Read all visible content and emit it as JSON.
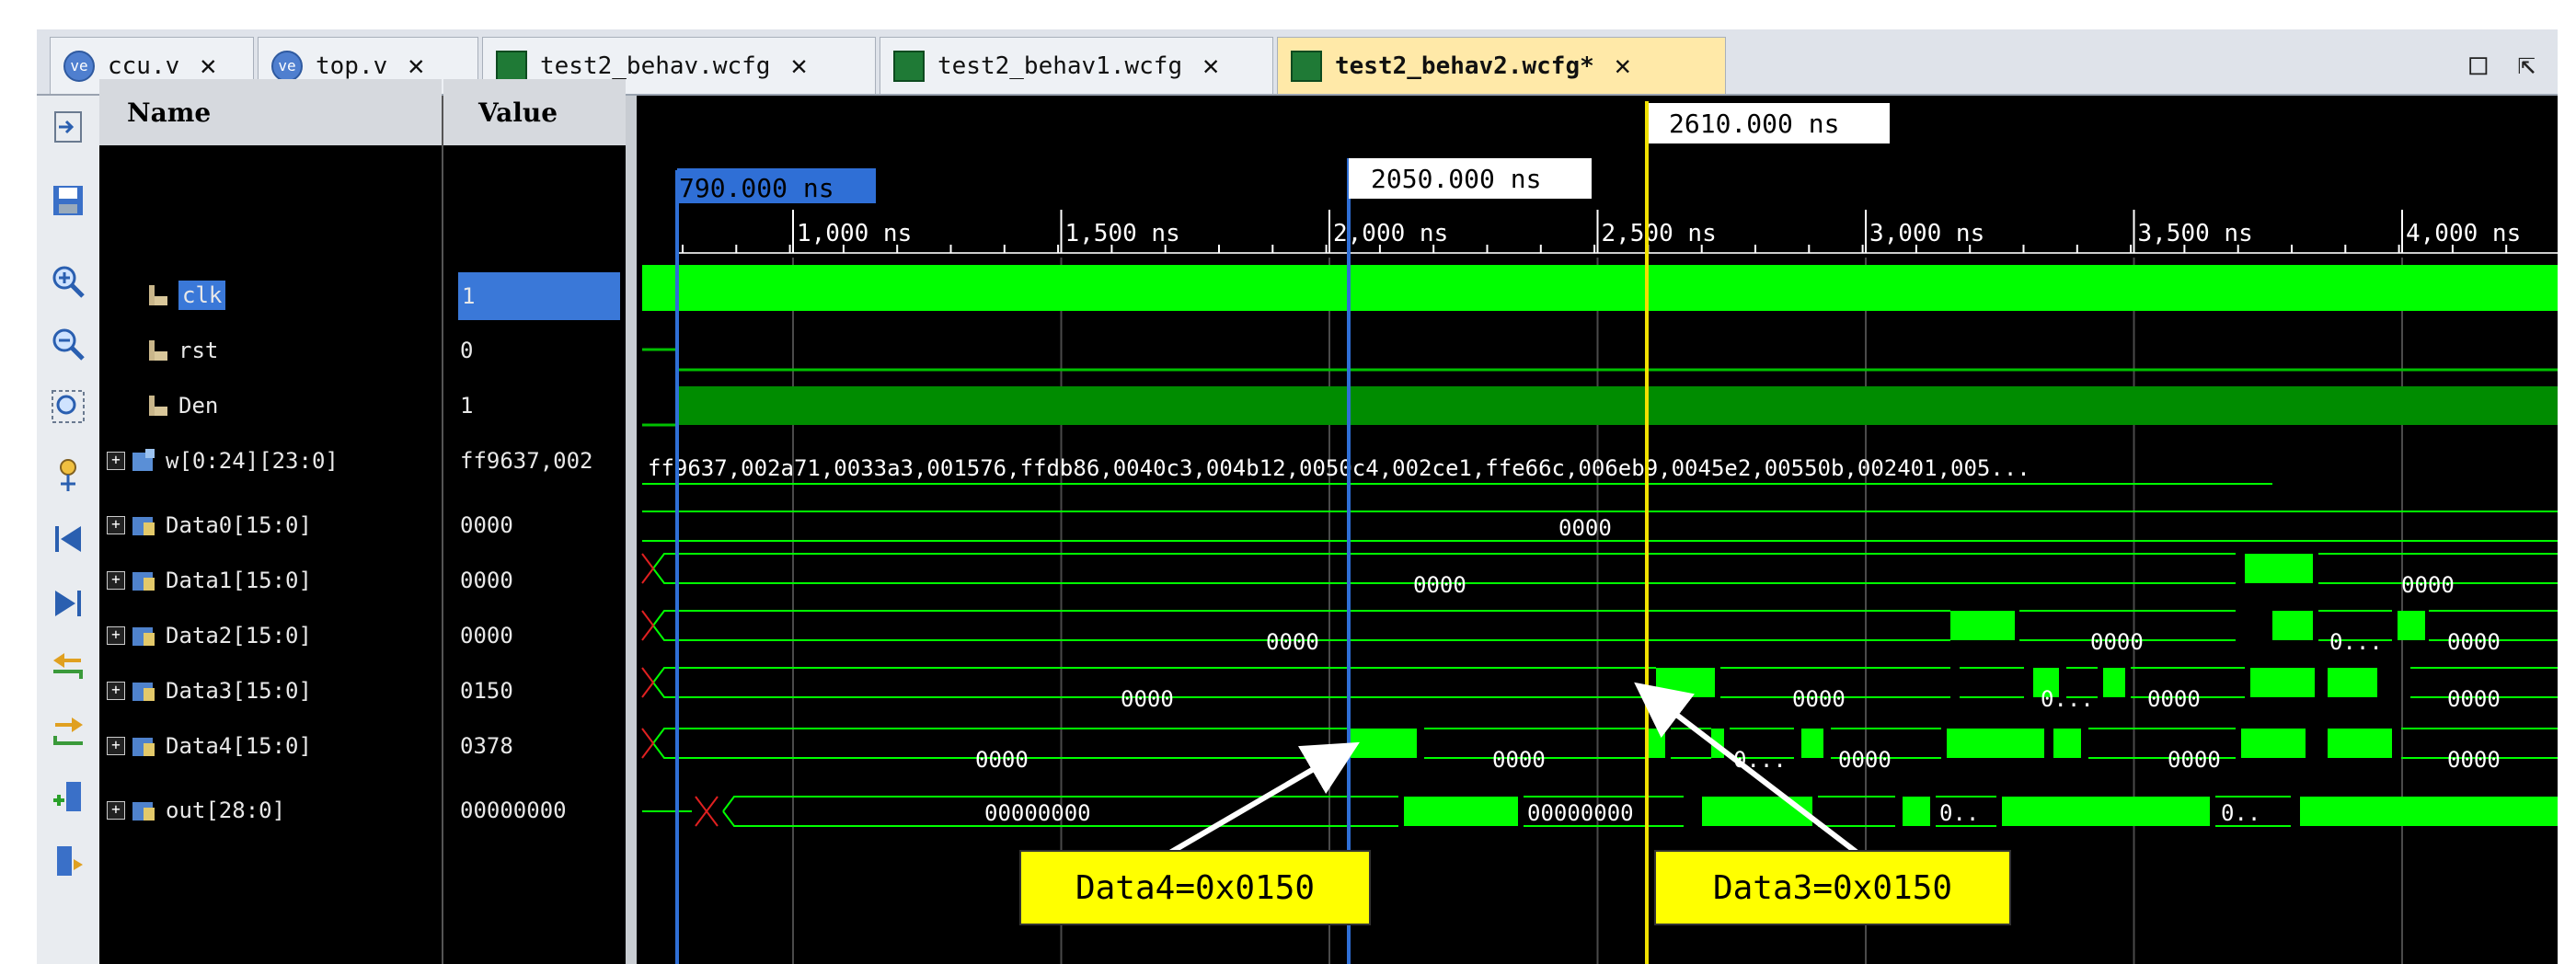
{
  "tabs": [
    {
      "label": "ccu.v",
      "icon": "verilog-file-icon"
    },
    {
      "label": "top.v",
      "icon": "verilog-file-icon"
    },
    {
      "label": "test2_behav.wcfg",
      "icon": "waveform-file-icon"
    },
    {
      "label": "test2_behav1.wcfg",
      "icon": "waveform-file-icon"
    },
    {
      "label": "test2_behav2.wcfg*",
      "icon": "waveform-file-icon",
      "active": true
    }
  ],
  "window_buttons": {
    "restore": "□",
    "maximize": "⇱"
  },
  "toolbar_icons": [
    "expand-icon",
    "save-icon",
    "zoom-in-icon",
    "zoom-out-icon",
    "zoom-fit-icon",
    "cursor-icon",
    "go-first-icon",
    "go-last-icon",
    "prev-transition-icon",
    "next-transition-icon",
    "add-marker-icon",
    "prev-marker-icon"
  ],
  "headers": {
    "name": "Name",
    "value": "Value"
  },
  "signals": [
    {
      "name": "clk",
      "value": "1",
      "type": "bit",
      "expandable": false,
      "selected": true
    },
    {
      "name": "rst",
      "value": "0",
      "type": "bit",
      "expandable": false
    },
    {
      "name": "Den",
      "value": "1",
      "type": "bit",
      "expandable": false
    },
    {
      "name": "w[0:24][23:0]",
      "value": "ff9637,002",
      "type": "bus",
      "expandable": true
    },
    {
      "name": "Data0[15:0]",
      "value": "0000",
      "type": "bus2",
      "expandable": true
    },
    {
      "name": "Data1[15:0]",
      "value": "0000",
      "type": "bus2",
      "expandable": true
    },
    {
      "name": "Data2[15:0]",
      "value": "0000",
      "type": "bus2",
      "expandable": true
    },
    {
      "name": "Data3[15:0]",
      "value": "0150",
      "type": "bus2",
      "expandable": true
    },
    {
      "name": "Data4[15:0]",
      "value": "0378",
      "type": "bus2",
      "expandable": true
    },
    {
      "name": "out[28:0]",
      "value": "00000000",
      "type": "bus2",
      "expandable": true
    }
  ],
  "timeline": {
    "ticks": [
      "1,000 ns",
      "1,500 ns",
      "2,000 ns",
      "2,500 ns",
      "3,000 ns",
      "3,500 ns",
      "4,000 ns"
    ],
    "markers": [
      {
        "label": "790.000 ns",
        "time_ns": 790,
        "color": "#2f6fd6"
      },
      {
        "label": "2050.000 ns",
        "time_ns": 2050,
        "color": "#2f6fd6"
      },
      {
        "label": "2610.000 ns",
        "time_ns": 2610,
        "color": "#f0e000"
      }
    ]
  },
  "wave_values": {
    "w": "ff9637,002a71,0033a3,001576,ffdb86,0040c3,004b12,0050c4,002ce1,ffe66c,006eb9,0045e2,00550b,002401,005...",
    "data0": [
      "0000"
    ],
    "data1": [
      "0000",
      "0000"
    ],
    "data2": [
      "0000",
      "0000",
      "0...",
      "0000"
    ],
    "data3": [
      "0000",
      "0000",
      "0...",
      "0000",
      "0000"
    ],
    "data4": [
      "0000",
      "0000",
      "0...",
      "0000",
      "0000",
      "0000"
    ],
    "out": [
      "00000000",
      "00000000",
      "0..",
      "0.."
    ]
  },
  "callouts": [
    {
      "text": "Data4=0x0150"
    },
    {
      "text": "Data3=0x0150"
    }
  ],
  "colors": {
    "wave": "#00ff00",
    "bg": "#000000",
    "selection": "#3a78d8",
    "marker_blue": "#2f6fd6",
    "marker_yellow": "#f0e000",
    "callout": "#ffff00"
  }
}
